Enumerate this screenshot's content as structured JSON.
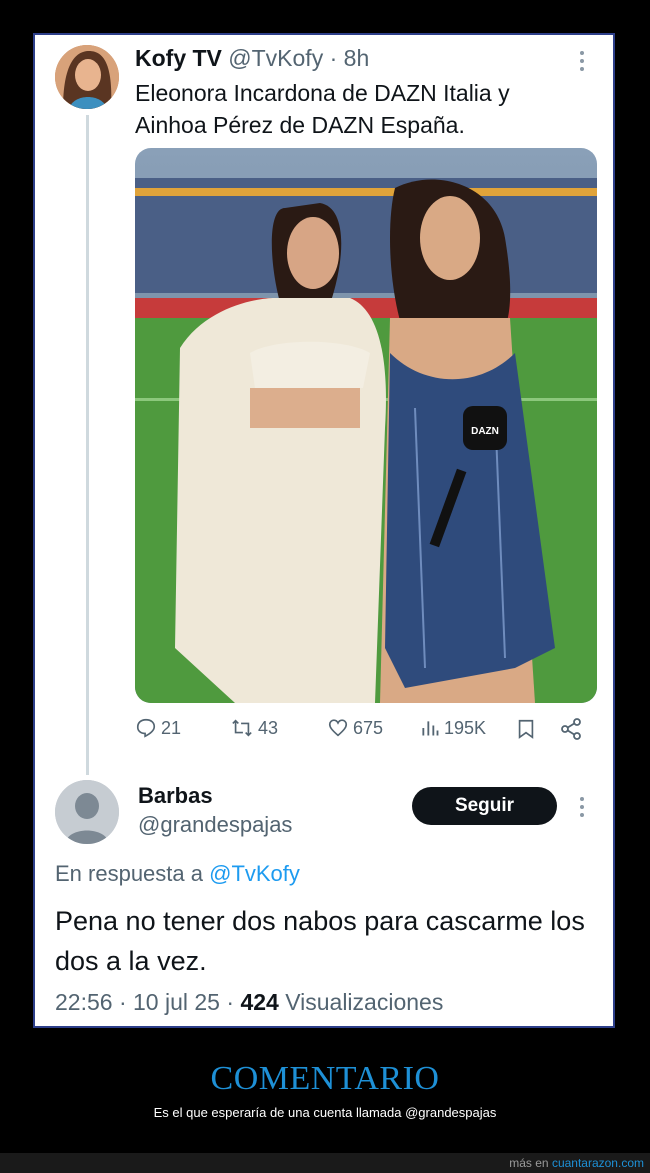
{
  "tweet": {
    "author_name": "Kofy TV",
    "author_handle": "@TvKofy",
    "separator": "·",
    "time": "8h",
    "text": "Eleonora Incardona de DAZN Italia y\nAinhoa Pérez de DAZN España.",
    "photo_logo": "DAZN",
    "stats": {
      "replies": "21",
      "retweets": "43",
      "likes": "675",
      "views": "195K"
    },
    "icons": [
      "more-icon",
      "reply-icon",
      "retweet-icon",
      "like-icon",
      "views-icon",
      "bookmark-icon",
      "share-icon"
    ]
  },
  "reply": {
    "author_name": "Barbas",
    "author_handle": "@grandespajas",
    "follow_label": "Seguir",
    "reply_prefix": "En respuesta a",
    "reply_mention": "@TvKofy",
    "text": "Pena no tener dos nabos para cascarme los dos a la vez.",
    "time": "22:56",
    "date": "10 jul 25",
    "views_count": "424",
    "views_label": "Visualizaciones"
  },
  "caption": {
    "title": "COMENTARIO",
    "subtitle": "Es el que esperaría de una cuenta llamada @grandespajas"
  },
  "footer": {
    "prefix": "más en",
    "site": "cuantarazon.com"
  },
  "colors": {
    "accent": "#1e90d6",
    "mention": "#1d9bf0",
    "card_border": "#2d3f8a",
    "follow_button": "#0f1419"
  }
}
